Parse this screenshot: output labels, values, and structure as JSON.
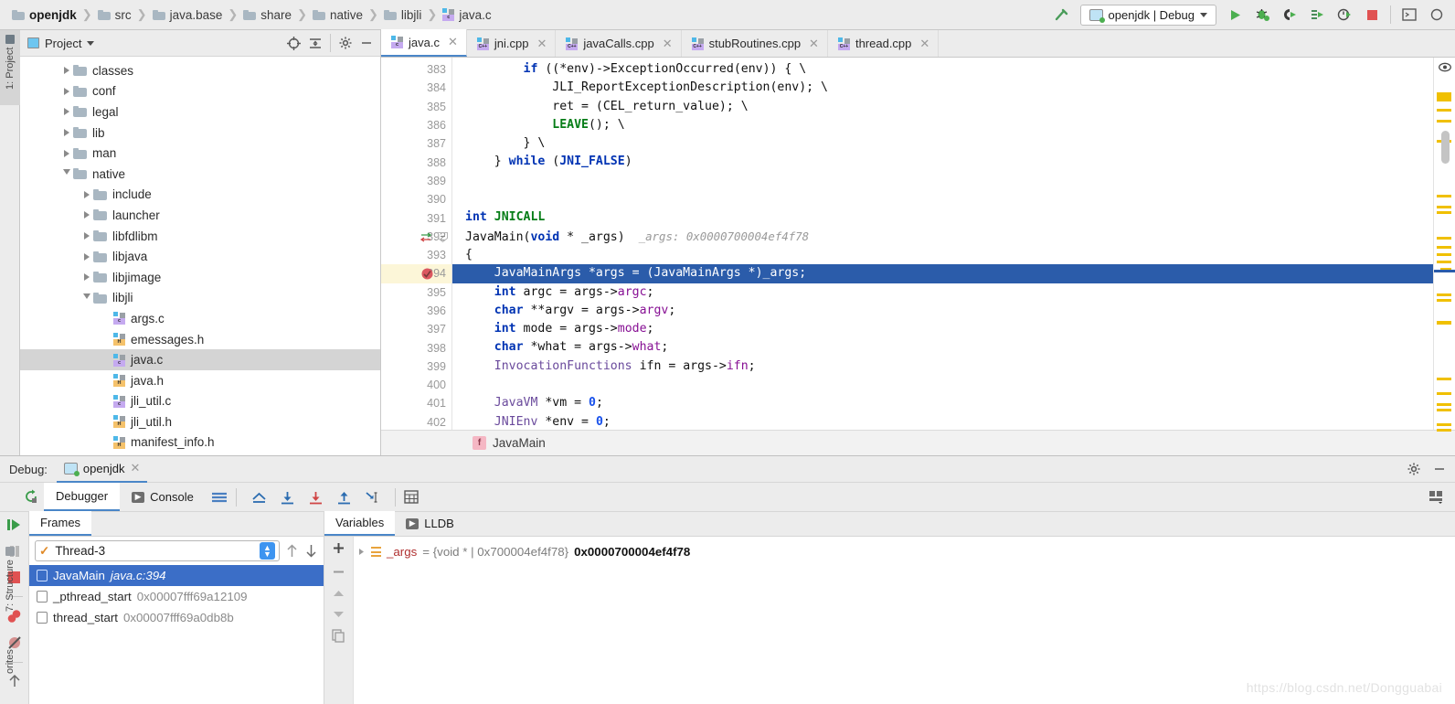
{
  "breadcrumbs": [
    {
      "label": "openjdk",
      "icon": "folder-icon",
      "bold": true
    },
    {
      "label": "src",
      "icon": "folder-icon"
    },
    {
      "label": "java.base",
      "icon": "folder-icon"
    },
    {
      "label": "share",
      "icon": "folder-icon"
    },
    {
      "label": "native",
      "icon": "folder-icon"
    },
    {
      "label": "libjli",
      "icon": "folder-icon"
    },
    {
      "label": "java.c",
      "icon": "c-file-icon"
    }
  ],
  "toolbar": {
    "run_config": "openjdk | Debug",
    "icons": [
      "hammer-icon",
      "run-icon",
      "debug-icon",
      "attach-debug-icon",
      "step-debug-icon",
      "profile-icon",
      "stop-icon",
      "console-icon",
      "more-icon"
    ]
  },
  "left_rail": [
    {
      "label": "1: Project",
      "selected": true
    },
    {
      "label": "7: Structure",
      "selected": false
    },
    {
      "label": "orites",
      "selected": false
    }
  ],
  "project": {
    "title": "Project",
    "tools": [
      "locate-icon",
      "collapse-all-icon",
      "gear-icon",
      "minimize-icon"
    ],
    "tree": [
      {
        "label": "classes",
        "type": "folder",
        "indent": 2,
        "state": "collapsed"
      },
      {
        "label": "conf",
        "type": "folder",
        "indent": 2,
        "state": "collapsed"
      },
      {
        "label": "legal",
        "type": "folder",
        "indent": 2,
        "state": "collapsed"
      },
      {
        "label": "lib",
        "type": "folder",
        "indent": 2,
        "state": "collapsed"
      },
      {
        "label": "man",
        "type": "folder",
        "indent": 2,
        "state": "collapsed"
      },
      {
        "label": "native",
        "type": "folder",
        "indent": 2,
        "state": "expanded"
      },
      {
        "label": "include",
        "type": "folder",
        "indent": 3,
        "state": "collapsed"
      },
      {
        "label": "launcher",
        "type": "folder",
        "indent": 3,
        "state": "collapsed"
      },
      {
        "label": "libfdlibm",
        "type": "folder",
        "indent": 3,
        "state": "collapsed"
      },
      {
        "label": "libjava",
        "type": "folder",
        "indent": 3,
        "state": "collapsed"
      },
      {
        "label": "libjimage",
        "type": "folder",
        "indent": 3,
        "state": "collapsed"
      },
      {
        "label": "libjli",
        "type": "folder",
        "indent": 3,
        "state": "expanded"
      },
      {
        "label": "args.c",
        "type": "c",
        "indent": 4
      },
      {
        "label": "emessages.h",
        "type": "h",
        "indent": 4
      },
      {
        "label": "java.c",
        "type": "c",
        "indent": 4,
        "selected": true
      },
      {
        "label": "java.h",
        "type": "h",
        "indent": 4
      },
      {
        "label": "jli_util.c",
        "type": "c",
        "indent": 4
      },
      {
        "label": "jli_util.h",
        "type": "h",
        "indent": 4
      },
      {
        "label": "manifest_info.h",
        "type": "h",
        "indent": 4
      }
    ]
  },
  "editor": {
    "tabs": [
      {
        "label": "java.c",
        "kind": "c",
        "active": true
      },
      {
        "label": "jni.cpp",
        "kind": "cpp"
      },
      {
        "label": "javaCalls.cpp",
        "kind": "cpp"
      },
      {
        "label": "stubRoutines.cpp",
        "kind": "cpp"
      },
      {
        "label": "thread.cpp",
        "kind": "cpp"
      }
    ],
    "first_line": 383,
    "current_line": 394,
    "breakpoint_line": 394,
    "inline_hint": "_args: 0x0000700004ef4f78",
    "breadcrumb_function": "JavaMain",
    "breadcrumb_badge": "f",
    "lines": [
      {
        "n": 383,
        "segs": [
          {
            "t": "        "
          },
          {
            "t": "if",
            "c": "k"
          },
          {
            "t": " ((*env)->"
          },
          {
            "t": "ExceptionOccurred"
          },
          {
            "t": "(env)) { \\"
          }
        ]
      },
      {
        "n": 384,
        "segs": [
          {
            "t": "            JLI_ReportExceptionDescription(env); \\"
          }
        ]
      },
      {
        "n": 385,
        "segs": [
          {
            "t": "            ret = (CEL_return_value); \\"
          }
        ]
      },
      {
        "n": 386,
        "segs": [
          {
            "t": "            "
          },
          {
            "t": "LEAVE",
            "c": "grn"
          },
          {
            "t": "(); \\"
          }
        ]
      },
      {
        "n": 387,
        "segs": [
          {
            "t": "        } \\"
          }
        ]
      },
      {
        "n": 388,
        "segs": [
          {
            "t": "    } "
          },
          {
            "t": "while",
            "c": "k"
          },
          {
            "t": " ("
          },
          {
            "t": "JNI_FALSE",
            "c": "k"
          },
          {
            "t": ")"
          }
        ]
      },
      {
        "n": 389,
        "segs": [
          {
            "t": ""
          }
        ]
      },
      {
        "n": 390,
        "segs": [
          {
            "t": ""
          }
        ]
      },
      {
        "n": 391,
        "segs": [
          {
            "t": ""
          },
          {
            "t": "int",
            "c": "k"
          },
          {
            "t": " "
          },
          {
            "t": "JNICALL",
            "c": "grn"
          }
        ]
      },
      {
        "n": 392,
        "segs": [
          {
            "t": "JavaMain("
          },
          {
            "t": "void",
            "c": "k"
          },
          {
            "t": " * _args)"
          }
        ],
        "hint": "_args: 0x0000700004ef4f78"
      },
      {
        "n": 393,
        "segs": [
          {
            "t": "{"
          }
        ]
      },
      {
        "n": 394,
        "segs": [
          {
            "t": "    JavaMainArgs *args = (JavaMainArgs *)_args;"
          }
        ],
        "current": true
      },
      {
        "n": 395,
        "segs": [
          {
            "t": "    "
          },
          {
            "t": "int",
            "c": "k"
          },
          {
            "t": " argc = args->"
          },
          {
            "t": "argc",
            "c": "mem"
          },
          {
            "t": ";"
          }
        ]
      },
      {
        "n": 396,
        "segs": [
          {
            "t": "    "
          },
          {
            "t": "char",
            "c": "k"
          },
          {
            "t": " **argv = args->"
          },
          {
            "t": "argv",
            "c": "mem"
          },
          {
            "t": ";"
          }
        ]
      },
      {
        "n": 397,
        "segs": [
          {
            "t": "    "
          },
          {
            "t": "int",
            "c": "k"
          },
          {
            "t": " mode = args->"
          },
          {
            "t": "mode",
            "c": "mem"
          },
          {
            "t": ";"
          }
        ]
      },
      {
        "n": 398,
        "segs": [
          {
            "t": "    "
          },
          {
            "t": "char",
            "c": "k"
          },
          {
            "t": " *what = args->"
          },
          {
            "t": "what",
            "c": "mem"
          },
          {
            "t": ";"
          }
        ]
      },
      {
        "n": 399,
        "segs": [
          {
            "t": "    "
          },
          {
            "t": "InvocationFunctions",
            "c": "ty"
          },
          {
            "t": " ifn = args->"
          },
          {
            "t": "ifn",
            "c": "mem"
          },
          {
            "t": ";"
          }
        ]
      },
      {
        "n": 400,
        "segs": [
          {
            "t": ""
          }
        ]
      },
      {
        "n": 401,
        "segs": [
          {
            "t": "    "
          },
          {
            "t": "JavaVM",
            "c": "ty"
          },
          {
            "t": " *vm = "
          },
          {
            "t": "0",
            "c": "num"
          },
          {
            "t": ";"
          }
        ]
      },
      {
        "n": 402,
        "segs": [
          {
            "t": "    "
          },
          {
            "t": "JNIEnv",
            "c": "ty"
          },
          {
            "t": " *env = "
          },
          {
            "t": "0",
            "c": "num"
          },
          {
            "t": ";"
          }
        ]
      }
    ]
  },
  "debug": {
    "label": "Debug:",
    "session_tab": "openjdk",
    "title_icons": [
      "gear-icon",
      "minimize-icon"
    ],
    "tabs": [
      {
        "label": "Debugger",
        "active": true
      },
      {
        "label": "Console",
        "active": false,
        "icon": "console-icon"
      }
    ],
    "step_icons": [
      "rerun-icon",
      "layout-icon",
      "show-execution-point-icon",
      "step-over-icon",
      "step-into-icon",
      "force-step-into-icon",
      "step-out-icon",
      "run-to-cursor-icon",
      "evaluate-icon"
    ],
    "rail_icons": [
      "resume-icon",
      "pause-icon",
      "stop-icon",
      "view-breakpoints-icon",
      "mute-breakpoints-icon",
      "settings-icon"
    ],
    "frames": {
      "header": "Frames",
      "thread": "Thread-3",
      "nav_icons": [
        "up-arrow-icon",
        "down-arrow-icon"
      ],
      "items": [
        {
          "name": "JavaMain",
          "location": "java.c:394",
          "selected": true,
          "italic": true
        },
        {
          "name": "_pthread_start",
          "location": "0x00007fff69a12109",
          "selected": false
        },
        {
          "name": "thread_start",
          "location": "0x00007fff69a0db8b",
          "selected": false
        }
      ]
    },
    "variables": {
      "tabs": [
        {
          "label": "Variables",
          "active": true
        },
        {
          "label": "LLDB",
          "active": false,
          "icon": "console-icon"
        }
      ],
      "side_icons": [
        "add-icon",
        "remove-icon",
        "up-icon",
        "down-icon",
        "copy-icon"
      ],
      "rows": [
        {
          "name": "_args",
          "type": "= {void * | 0x700004ef4f78}",
          "value": "0x0000700004ef4f78"
        }
      ]
    }
  },
  "watermark": "https://blog.csdn.net/Dongguabai",
  "colors": {
    "accent": "#4a86c8",
    "selection": "#2b5caa",
    "warning": "#f0c000",
    "run": "#4caf50",
    "stop": "#e05252"
  }
}
